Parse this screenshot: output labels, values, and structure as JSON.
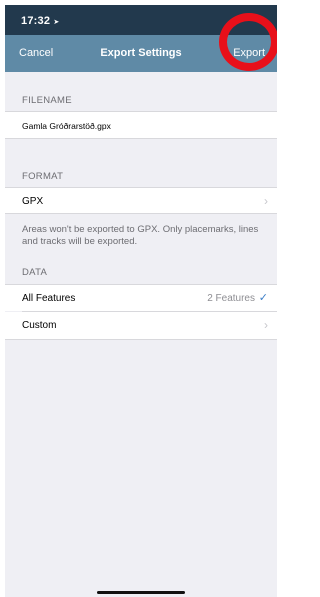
{
  "status": {
    "time": "17:32",
    "location_arrow": "➤",
    "right": ""
  },
  "nav": {
    "cancel": "Cancel",
    "title": "Export Settings",
    "export": "Export"
  },
  "filename": {
    "header": "FILENAME",
    "value": "Gamla Gróðrarstöð.gpx"
  },
  "format": {
    "header": "FORMAT",
    "value": "GPX",
    "note": "Areas won't be exported to GPX. Only placemarks, lines and tracks will be exported."
  },
  "data": {
    "header": "DATA",
    "all_features_label": "All Features",
    "all_features_count": "2 Features",
    "custom_label": "Custom"
  },
  "icons": {
    "chevron": "›",
    "check": "✓"
  },
  "colors": {
    "statusbar": "#22394d",
    "navbar": "#5f8aa6",
    "annotation": "#e8101a",
    "check": "#3d7fc7"
  }
}
